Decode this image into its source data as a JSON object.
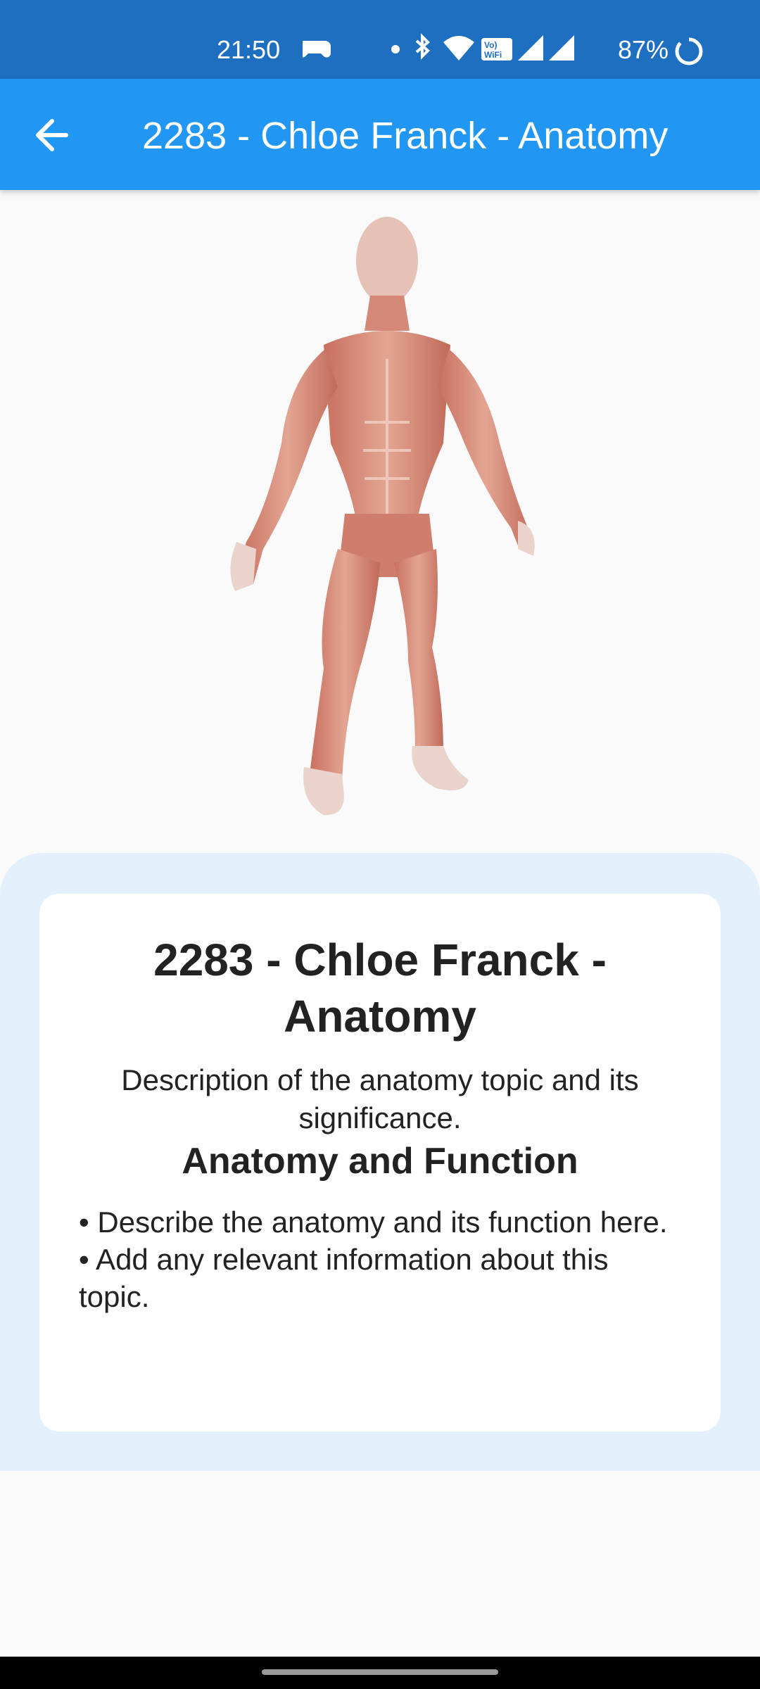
{
  "status_bar": {
    "time": "21:50",
    "battery": "87%"
  },
  "app_bar": {
    "title": "2283 - Chloe Franck - Anatomy",
    "back_icon": "arrow-left-icon"
  },
  "model_viewer": {
    "image": "muscular-anatomy-figure",
    "ar_icon": "view-in-ar-icon"
  },
  "card": {
    "title": "2283 - Chloe Franck - Anatomy",
    "description": "Description of the anatomy topic and its significance.",
    "subtitle": "Anatomy and Function",
    "bullets": [
      "• Describe the anatomy and its function here.",
      "• Add any relevant information about this topic."
    ]
  },
  "colors": {
    "status_bar": "#1e6fbf",
    "app_bar": "#2196f3",
    "panel": "#e3f0fc",
    "card": "#ffffff",
    "background": "#fafafa"
  }
}
